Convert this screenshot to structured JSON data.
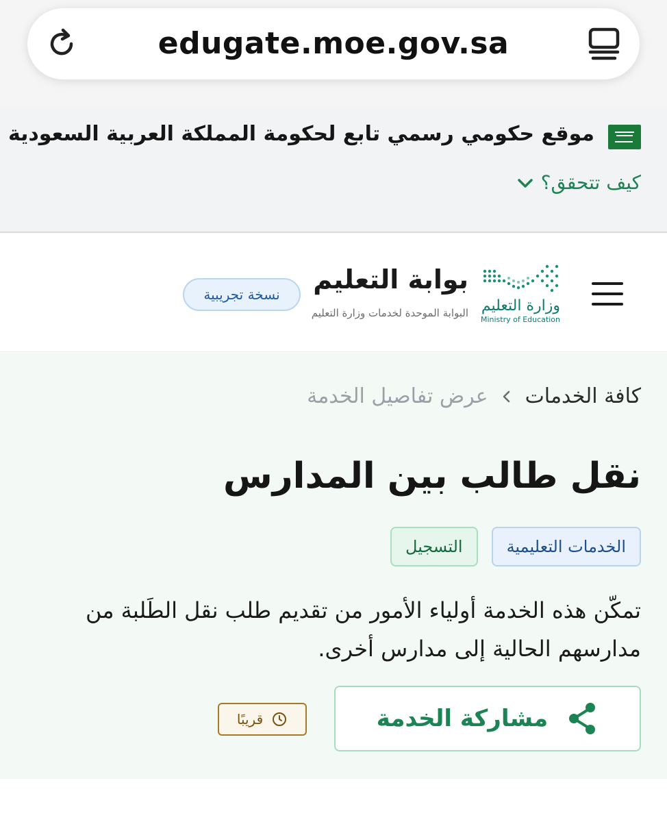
{
  "browser": {
    "url": "edugate.moe.gov.sa",
    "reload_icon": "reload-icon",
    "reader_icon": "reader-mode-icon"
  },
  "gov_banner": {
    "text": "موقع حكومي رسمي تابع لحكومة المملكة العربية السعودية",
    "verify_label": "كيف تتحقق؟",
    "accent": "#1b8354"
  },
  "header": {
    "ministry_ar": "وزارة التعليم",
    "ministry_en": "Ministry of Education",
    "portal_title": "بوابة التعليم",
    "portal_subtitle": "البوابة الموحدة لخدمات وزارة التعليم",
    "beta_badge": "نسخة تجريبية"
  },
  "breadcrumb": {
    "items": [
      "كافة الخدمات",
      "عرض تفاصيل الخدمة"
    ]
  },
  "service": {
    "title": "نقل طالب بين المدارس",
    "tags": [
      "الخدمات التعليمية",
      "التسجيل"
    ],
    "description": "تمكّن هذه الخدمة أولياء الأمور من تقديم طلب نقل الطَلبة من مدارسهم الحالية إلى مدارس أخرى.",
    "share_label": "مشاركة الخدمة",
    "status_label": "قريبًا"
  }
}
